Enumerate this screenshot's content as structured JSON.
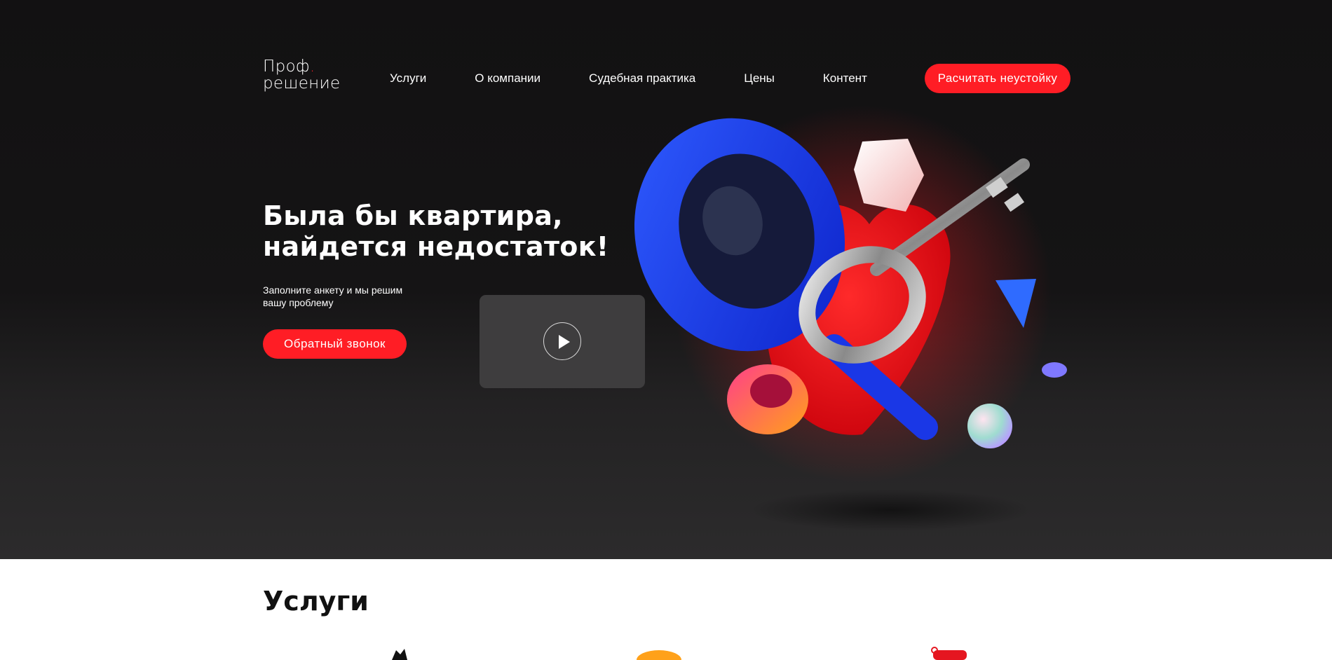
{
  "logo": {
    "line1": "Проф",
    "dot": ".",
    "line2": "решение"
  },
  "nav": [
    {
      "label": "Услуги"
    },
    {
      "label": "О компании"
    },
    {
      "label": "Судебная практика"
    },
    {
      "label": "Цены"
    },
    {
      "label": "Контент"
    }
  ],
  "header_cta": "Расчитать неустойку",
  "hero": {
    "title_line1": "Была бы квартира,",
    "title_line2": "найдется недостаток!",
    "subtitle_line1": "Заполните анкету и мы решим",
    "subtitle_line2": "вашу проблему",
    "callback_button": "Обратный звонок",
    "video_play_icon": "play-icon",
    "illustration": "magnifier-key-heart-3d"
  },
  "services": {
    "title": "Услуги"
  },
  "colors": {
    "accent": "#ff1d25",
    "hero_bg": "#141314",
    "magnifier": "#1f3df0",
    "video_bg": "#3e3d3e"
  }
}
